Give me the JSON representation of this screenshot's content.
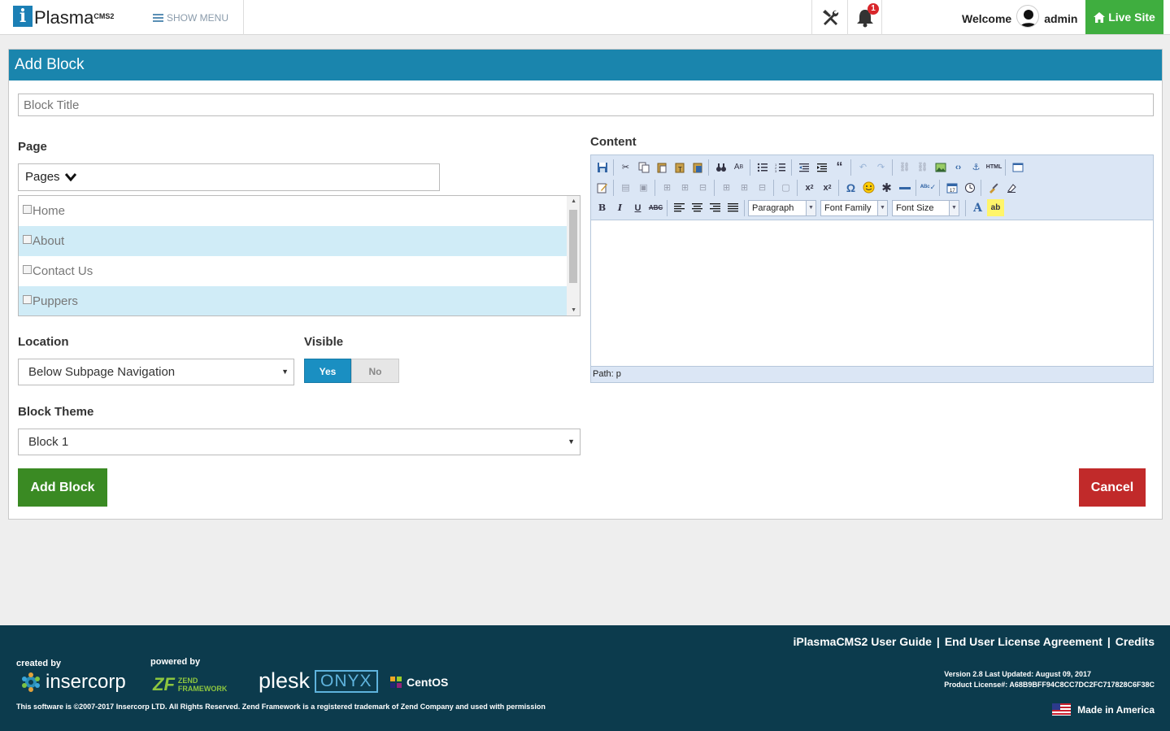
{
  "topbar": {
    "logo_text": "Plasma",
    "logo_sup": "CMS2",
    "show_menu": "SHOW MENU",
    "notification_count": "1",
    "welcome": "Welcome",
    "username": "admin",
    "live_site": "Live Site"
  },
  "panel": {
    "heading": "Add Block",
    "title_placeholder": "Block Title",
    "page_label": "Page",
    "pages_select": "Pages",
    "pages": [
      "Home",
      "About",
      "Contact Us",
      "Puppers"
    ],
    "location_label": "Location",
    "location_value": "Below Subpage Navigation",
    "visible_label": "Visible",
    "visible_yes": "Yes",
    "visible_no": "No",
    "visible_value": "Yes",
    "theme_label": "Block Theme",
    "theme_value": "Block 1",
    "content_label": "Content",
    "add_button": "Add Block",
    "cancel_button": "Cancel"
  },
  "editor": {
    "format_select": "Paragraph",
    "font_family_select": "Font Family",
    "font_size_select": "Font Size",
    "path": "Path: p"
  },
  "footer": {
    "links": [
      "iPlasmaCMS2 User Guide",
      "End User License Agreement",
      "Credits"
    ],
    "created_by": "created by",
    "powered_by": "powered by",
    "insercorp": "insercorp",
    "zend_line1": "ZEND",
    "zend_line2": "FRAMEWORK",
    "plesk": "plesk",
    "onyx": "ONYX",
    "centos": "CentOS",
    "copyright": "This software is ©2007-2017 Insercorp LTD. All Rights Reserved. Zend Framework is a registered trademark of Zend Company and used with permission",
    "version": "Version 2.8 Last Updated: August 09, 2017",
    "license": "Product License#: A68B9BFF94C8CC7DC2FC717828C6F38C",
    "made_in": "Made in America"
  },
  "colors": {
    "header_blue": "#1a85ad",
    "live_site_green": "#3fae3f",
    "add_green": "#3a8a23",
    "cancel_red": "#c12a2a",
    "footer_bg": "#0c3b4d",
    "row_highlight": "#d0ecf7"
  }
}
